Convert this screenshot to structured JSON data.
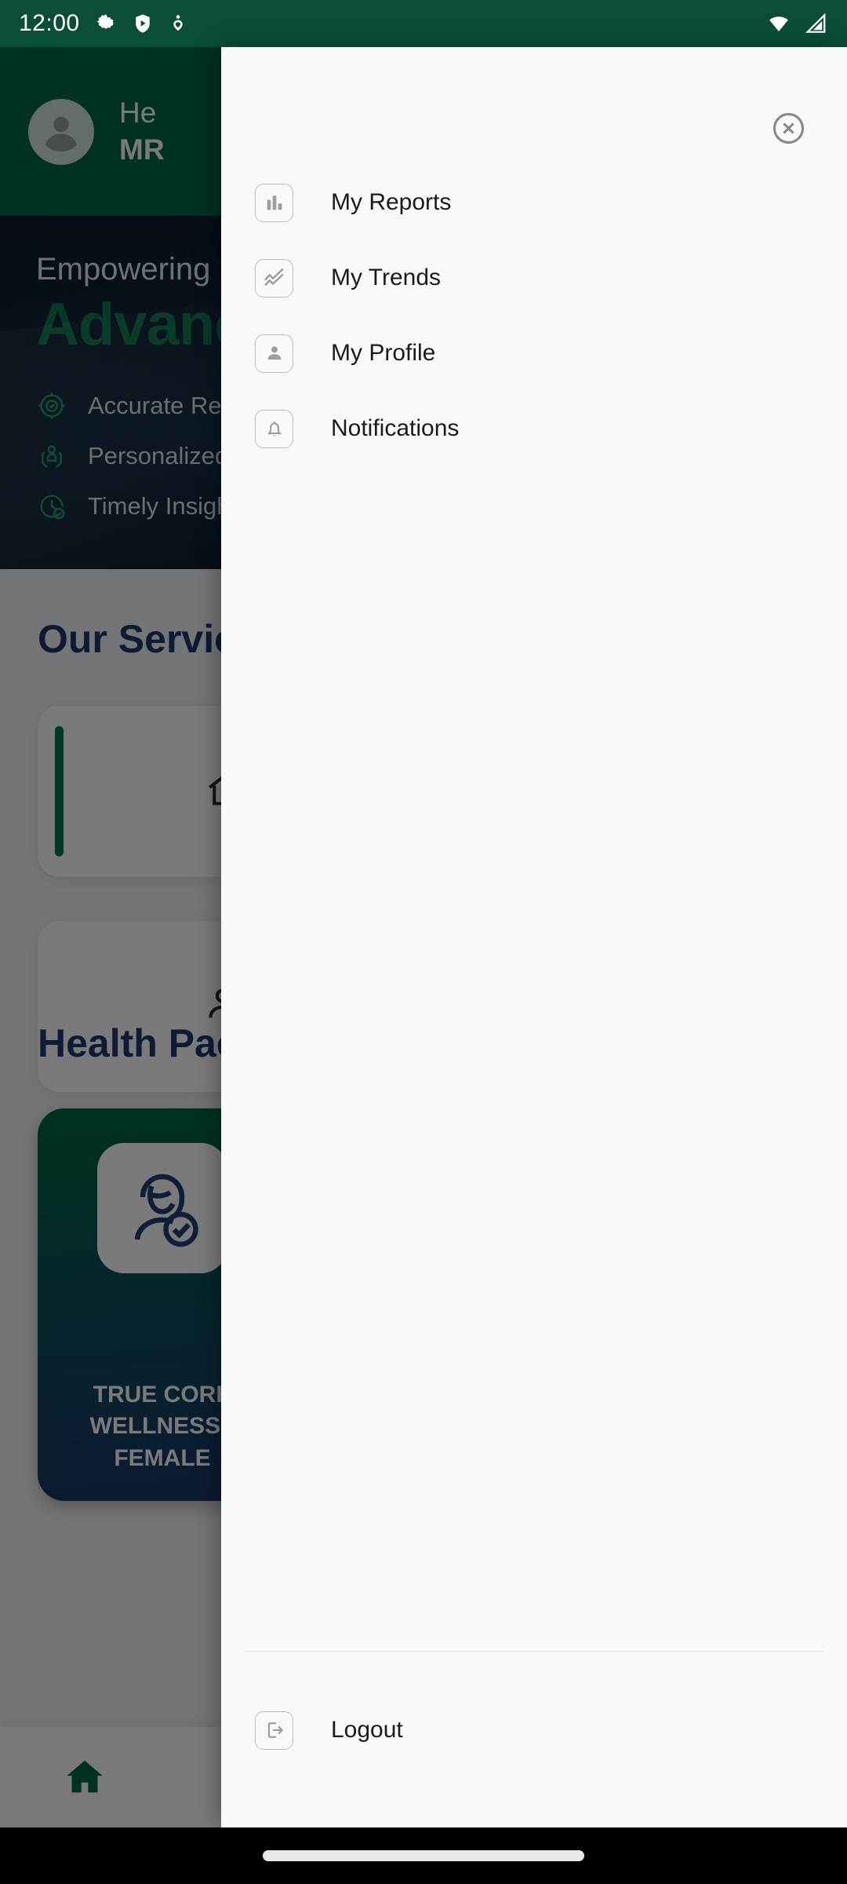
{
  "status_bar": {
    "time": "12:00",
    "left_icons": [
      "gear-icon",
      "shield-play-icon",
      "heart-pulse-icon"
    ],
    "right_icons": [
      "wifi-icon",
      "cellular-signal-icon"
    ],
    "background_color": "#0b4d3b"
  },
  "background_app": {
    "header": {
      "avatar": "person-avatar-icon",
      "greeting": "He",
      "name": "MR",
      "background_color": "#00664a"
    },
    "hero": {
      "subtitle": "Empowering",
      "title": "Advanc",
      "features": [
        {
          "icon": "target-check-icon",
          "label": "Accurate Resu"
        },
        {
          "icon": "care-hands-icon",
          "label": "Personalized"
        },
        {
          "icon": "clock-check-icon",
          "label": "Timely Insight"
        }
      ]
    },
    "services": {
      "title": "Our Service",
      "cards": [
        {
          "icon": "home-icon",
          "accent_color": "#00784e"
        },
        {
          "icon": "person-add-icon",
          "accent_color": "#00784e"
        }
      ]
    },
    "packages": {
      "title": "Health Pac",
      "cards": [
        {
          "icon": "female-check-icon",
          "name": "TRUE CORE WELLNESS - FEMALE"
        }
      ]
    },
    "bottom_nav": {
      "items": [
        {
          "icon": "home-icon",
          "active": true,
          "active_color": "#00664a"
        }
      ]
    }
  },
  "drawer": {
    "close_button": "close-circle-icon",
    "items": [
      {
        "icon": "bar-chart-icon",
        "label": "My Reports"
      },
      {
        "icon": "trend-line-icon",
        "label": "My Trends"
      },
      {
        "icon": "person-icon",
        "label": "My Profile"
      },
      {
        "icon": "bell-icon",
        "label": "Notifications"
      }
    ],
    "logout": {
      "icon": "logout-icon",
      "label": "Logout"
    },
    "background_color": "#f8f9fa"
  },
  "system_nav": {
    "gesture_pill": true
  }
}
